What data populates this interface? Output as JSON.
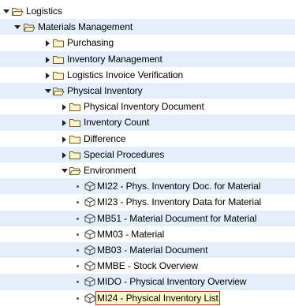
{
  "tree": {
    "nodes": [
      {
        "label": "Logistics",
        "state": "expanded",
        "icon": "folder-open-icon"
      },
      {
        "label": "Materials Management",
        "state": "expanded",
        "icon": "folder-open-icon"
      },
      {
        "label": "Purchasing",
        "state": "collapsed",
        "icon": "folder-closed-icon"
      },
      {
        "label": "Inventory Management",
        "state": "collapsed",
        "icon": "folder-closed-icon"
      },
      {
        "label": "Logistics Invoice Verification",
        "state": "collapsed",
        "icon": "folder-closed-icon"
      },
      {
        "label": "Physical Inventory",
        "state": "expanded",
        "icon": "folder-open-icon"
      },
      {
        "label": "Physical Inventory Document",
        "state": "collapsed",
        "icon": "folder-closed-icon"
      },
      {
        "label": "Inventory Count",
        "state": "collapsed",
        "icon": "folder-closed-icon"
      },
      {
        "label": "Difference",
        "state": "collapsed",
        "icon": "folder-closed-icon"
      },
      {
        "label": "Special Procedures",
        "state": "collapsed",
        "icon": "folder-closed-icon"
      },
      {
        "label": "Environment",
        "state": "expanded",
        "icon": "folder-open-icon"
      },
      {
        "label": "MI22 - Phys. Inventory Doc. for Material",
        "state": "leaf",
        "icon": "transaction-cube-icon"
      },
      {
        "label": "MI23 - Phys. Inventory Data for Material",
        "state": "leaf",
        "icon": "transaction-cube-icon"
      },
      {
        "label": "MB51 - Material Document for Material",
        "state": "leaf",
        "icon": "transaction-cube-icon"
      },
      {
        "label": "MM03 - Material",
        "state": "leaf",
        "icon": "transaction-cube-icon"
      },
      {
        "label": "MB03 - Material Document",
        "state": "leaf",
        "icon": "transaction-cube-icon"
      },
      {
        "label": "MMBE - Stock Overview",
        "state": "leaf",
        "icon": "transaction-cube-icon"
      },
      {
        "label": "MIDO - Physical Inventory Overview",
        "state": "leaf",
        "icon": "transaction-cube-icon"
      },
      {
        "label": "MI24 - Physical Inventory List",
        "state": "leaf",
        "selected": true,
        "icon": "transaction-cube-icon"
      }
    ]
  },
  "colors": {
    "band": "#e4effb",
    "folder_fill": "#fff6c8",
    "folder_stroke": "#6f5a2a",
    "toggle": "#222222",
    "cube": "#555555",
    "selection_outline": "#e02020",
    "selection_fill": "#fff8c8"
  }
}
